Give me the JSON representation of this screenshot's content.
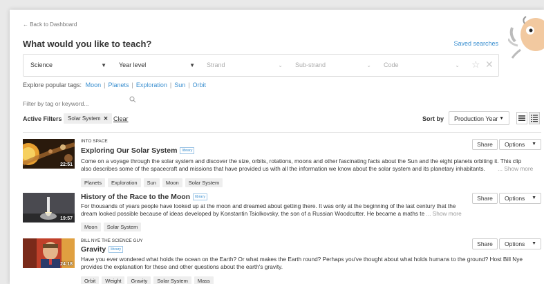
{
  "nav": {
    "back_label": "← Back to Dashboard"
  },
  "header": {
    "title": "What would you like to teach?",
    "saved_searches": "Saved searches"
  },
  "filters": {
    "subject": "Science",
    "year_level": "Year level",
    "strand": "Strand",
    "sub_strand": "Sub-strand",
    "code": "Code"
  },
  "popular_tags": {
    "label": "Explore popular tags:",
    "tags": [
      "Moon",
      "Planets",
      "Exploration",
      "Sun",
      "Orbit"
    ]
  },
  "search": {
    "placeholder": "Filter by tag or keyword..."
  },
  "active_filters": {
    "label": "Active Filters",
    "chips": [
      "Solar System"
    ],
    "clear_label": "Clear"
  },
  "sort": {
    "label": "Sort by",
    "selected": "Production Year"
  },
  "results": [
    {
      "series": "INTO SPACE",
      "title": "Exploring Our Solar System",
      "badge": "library",
      "duration": "22:51",
      "desc1": "Come on a voyage through the solar system and discover the size, orbits, rotations, moons and other fascinating facts about the Sun and the eight planets orbiting it. This clip",
      "desc2": "also describes some of the spacecraft and missions that have provided us with all the information we know about the solar system and its planetary inhabitants.",
      "more": "... Show more",
      "tags": [
        "Planets",
        "Exploration",
        "Sun",
        "Moon",
        "Solar System"
      ]
    },
    {
      "series": "",
      "title": "History of the Race to the Moon",
      "badge": "library",
      "duration": "19:57",
      "desc1": "For thousands of years people have looked up at the moon and dreamed about getting there. It was only at the beginning of the last century that the",
      "desc2": "dream looked possible because of ideas developed by Konstantin Tsiolkovsky, the son of a Russian Woodcutter. He became a maths te",
      "more": "... Show more",
      "tags": [
        "Moon",
        "Solar System"
      ]
    },
    {
      "series": "BILL NYE THE SCIENCE GUY",
      "title": "Gravity",
      "badge": "library",
      "duration": "24:18",
      "desc1": "Have you ever wondered what holds the ocean on the Earth? Or what makes the Earth round? Perhaps you've thought about what holds humans to the ground? Host Bill Nye",
      "desc2": "provides the explanation for these and other questions about the earth's gravity.",
      "more": "",
      "tags": [
        "Orbit",
        "Weight",
        "Gravity",
        "Solar System",
        "Mass"
      ]
    }
  ],
  "actions": {
    "share": "Share",
    "options": "Options"
  },
  "colors": {
    "link": "#3a8fd0",
    "tag_bg": "#eeeeee"
  }
}
